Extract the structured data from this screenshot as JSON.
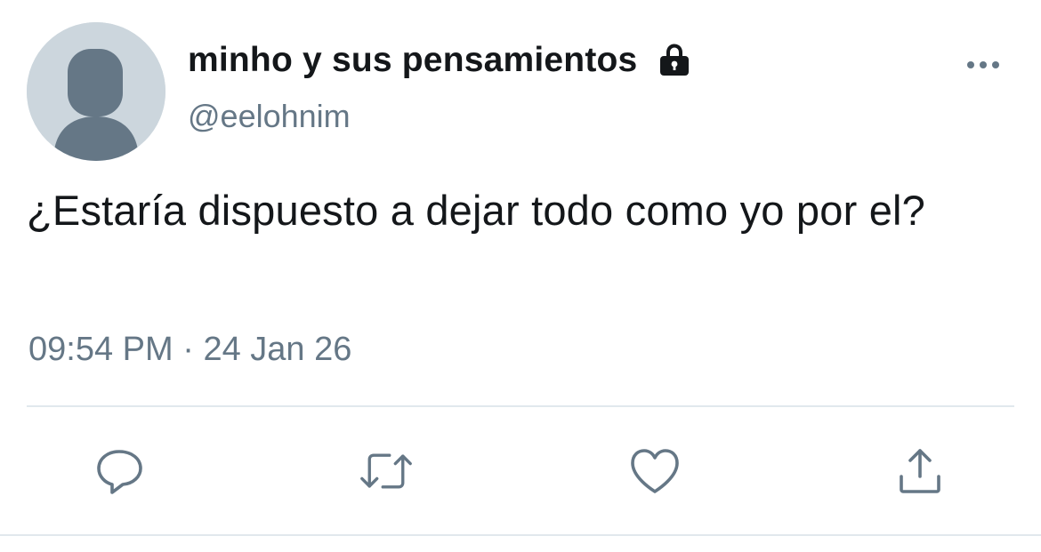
{
  "tweet": {
    "display_name": "minho y sus pensamientos",
    "handle": "@eelohnim",
    "text": "¿Estaría dispuesto a dejar todo como yo por el?",
    "time": "09:54 PM",
    "separator": "·",
    "date": "24 Jan 26"
  },
  "icons": {
    "avatar": "default-avatar-icon",
    "lock": "lock-icon",
    "more": "more-icon",
    "reply": "reply-icon",
    "retweet": "retweet-icon",
    "like": "heart-icon",
    "share": "share-icon"
  },
  "colors": {
    "text": "#14171a",
    "secondary": "#657786",
    "icon": "#657786",
    "avatar_bg": "#ccd6dd",
    "avatar_fg": "#657786",
    "divider": "#e1e8ed"
  }
}
